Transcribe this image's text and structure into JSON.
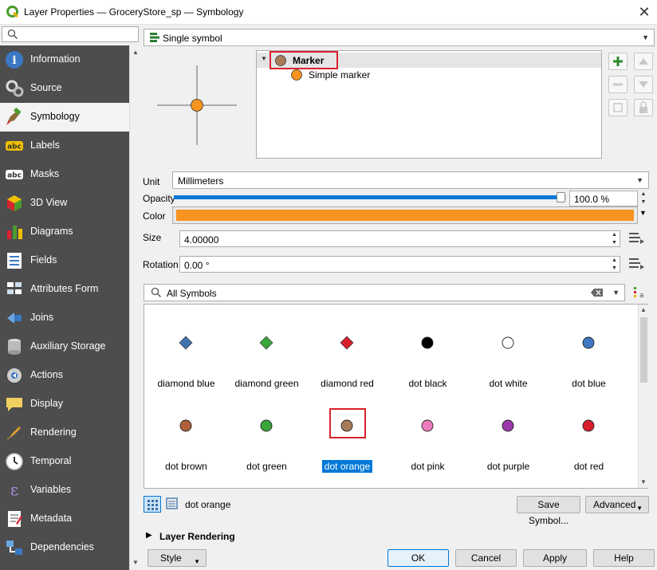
{
  "window": {
    "title": "Layer Properties — GroceryStore_sp — Symbology",
    "close": "✕"
  },
  "sidebar": {
    "items": [
      {
        "label": "Information",
        "icon": "information-icon"
      },
      {
        "label": "Source",
        "icon": "source-icon"
      },
      {
        "label": "Symbology",
        "icon": "symbology-brush-icon",
        "active": true
      },
      {
        "label": "Labels",
        "icon": "labels-abc-icon"
      },
      {
        "label": "Masks",
        "icon": "masks-abc-icon"
      },
      {
        "label": "3D View",
        "icon": "3d-cube-icon"
      },
      {
        "label": "Diagrams",
        "icon": "diagrams-icon"
      },
      {
        "label": "Fields",
        "icon": "fields-icon"
      },
      {
        "label": "Attributes Form",
        "icon": "attributes-form-icon"
      },
      {
        "label": "Joins",
        "icon": "joins-icon"
      },
      {
        "label": "Auxiliary Storage",
        "icon": "auxiliary-storage-icon"
      },
      {
        "label": "Actions",
        "icon": "actions-gear-icon"
      },
      {
        "label": "Display",
        "icon": "display-speech-icon"
      },
      {
        "label": "Rendering",
        "icon": "rendering-brush-icon"
      },
      {
        "label": "Temporal",
        "icon": "temporal-clock-icon"
      },
      {
        "label": "Variables",
        "icon": "variables-epsilon-icon"
      },
      {
        "label": "Metadata",
        "icon": "metadata-icon"
      },
      {
        "label": "Dependencies",
        "icon": "dependencies-icon"
      }
    ]
  },
  "renderer": {
    "value": "Single symbol"
  },
  "symbol_tree": {
    "root": "Marker",
    "child": "Simple marker"
  },
  "props": {
    "unit_label": "Unit",
    "unit_value": "Millimeters",
    "opacity_label": "Opacity",
    "opacity_value": "100.0 %",
    "opacity_fraction": 1.0,
    "color_label": "Color",
    "color_value": "#f7931e",
    "size_label": "Size",
    "size_value": "4.00000",
    "rotation_label": "Rotation",
    "rotation_value": "0.00 °"
  },
  "library": {
    "filter": "All Symbols",
    "symbols": [
      {
        "name": "diamond blue",
        "shape": "diamond",
        "color": "#3f73b0"
      },
      {
        "name": "diamond green",
        "shape": "diamond",
        "color": "#3aa63a"
      },
      {
        "name": "diamond red",
        "shape": "diamond",
        "color": "#d81e2c"
      },
      {
        "name": "dot  black",
        "shape": "dot",
        "color": "#000000"
      },
      {
        "name": "dot  white",
        "shape": "dot",
        "color": "#ffffff"
      },
      {
        "name": "dot blue",
        "shape": "dot",
        "color": "#3f78c0"
      },
      {
        "name": "dot brown",
        "shape": "dot",
        "color": "#b0603a"
      },
      {
        "name": "dot green",
        "shape": "dot",
        "color": "#3aa63a"
      },
      {
        "name": "dot orange",
        "shape": "dot",
        "color": "#a87b58",
        "selected": true
      },
      {
        "name": "dot pink",
        "shape": "dot",
        "color": "#f07cc0"
      },
      {
        "name": "dot purple",
        "shape": "dot",
        "color": "#9a3aa8"
      },
      {
        "name": "dot red",
        "shape": "dot",
        "color": "#d81e2c"
      }
    ],
    "selected_name": "dot orange"
  },
  "buttons": {
    "save_symbol": "Save Symbol...",
    "advanced": "Advanced",
    "layer_rendering": "Layer Rendering",
    "style": "Style",
    "ok": "OK",
    "cancel": "Cancel",
    "apply": "Apply",
    "help": "Help"
  },
  "colors": {
    "accent": "#0078d7",
    "marker_orange": "#f7931e",
    "marker_brown": "#a87b58",
    "highlight_red": "#d9232e",
    "nav_bg": "#4d4d4d"
  }
}
